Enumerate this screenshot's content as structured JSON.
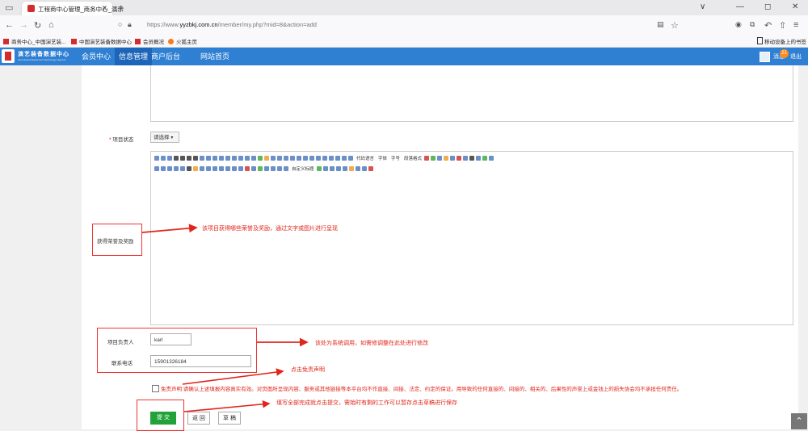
{
  "browser": {
    "tab_title": "工程商中心管理_商务中心_演示",
    "address_url_prefix": "https://www.",
    "address_url_domain": "yyzbkj.com.cn",
    "address_url_path": "/member/my.php?mid=8&action=add",
    "bookmarks": [
      "商务中心_中国演艺装...",
      "中国演艺装备数据中心",
      "会员概况",
      "火狐主页"
    ],
    "mobile_bookmarks": "移动设备上的书签"
  },
  "header": {
    "logo_title": "演艺装备数据中心",
    "logo_subtitle": "International Equipment Technology Network",
    "menu": [
      "会员中心",
      "信息管理",
      "商户后台",
      "网站首页"
    ],
    "active_menu": "信息管理",
    "messages_label": "消息",
    "messages_count": "21",
    "logout_label": "退出"
  },
  "form": {
    "status_label": "项目状态",
    "status_required_mark": "*",
    "status_select": "请选择",
    "editor_toolbar_words": [
      "代码语言",
      "字体",
      "字号",
      "段落格式",
      "自定义标题"
    ],
    "awards_label": "获得荣誉及奖励",
    "leader_label": "项目负责人",
    "leader_value": "karl",
    "phone_label": "联系电话",
    "phone_value": "15901326184",
    "disclaimer": "免责声明:请确认上述填报内容真实有效。对页面所呈现内容、服务或其他链接等本平台均不作直接、间接、法定、约定的保证。用导致的任何直接的、间接的、相关的、后果性的声誉上或金钱上的损失协会均不承担任何责任。",
    "submit_label": "提 交",
    "back_label": "返 回",
    "draft_label": "草 稿"
  },
  "annotations": {
    "awards_note": "该项目获得哪些荣誉及奖励，通过文字或图片进行呈现",
    "contact_note": "该处为系统调用，如需修调整在此处进行修改",
    "disclaimer_note": "点击免责声明",
    "submit_note": "填写全部完成就点击提交，需始时有剩的工作可以暂存点击草稿进行保存"
  },
  "colors": {
    "nav_blue": "#2f7fd3",
    "annotation_red": "#e0261b",
    "submit_green": "#22a33a"
  }
}
